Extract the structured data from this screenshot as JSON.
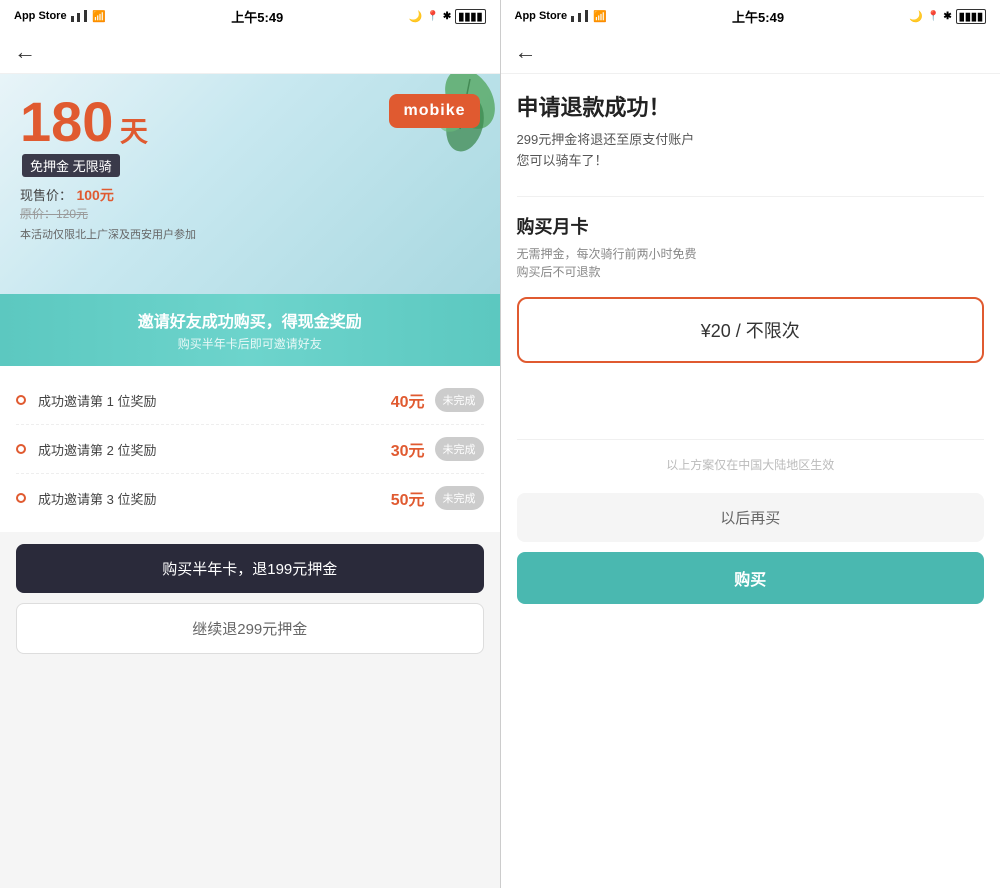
{
  "left_screen": {
    "status_bar": {
      "carrier": "App Store",
      "signal": "●●●",
      "wifi": "WiFi",
      "time": "上午5:49",
      "battery": "■■■■"
    },
    "back_label": "←",
    "hero": {
      "days": "180",
      "days_unit": "天",
      "badge_text": "免押金 无限骑",
      "price_label": "现售价：",
      "price_value": "100元",
      "original_price": "原价：120元",
      "note": "本活动仅限北上广深及西安用户参加",
      "brand": "mobike"
    },
    "invite_ribbon": {
      "title": "邀请好友成功购买，得现金奖励",
      "sub": "购买半年卡后即可邀请好友"
    },
    "rewards": [
      {
        "text": "成功邀请第 1 位奖励",
        "amount": "40元",
        "btn_label": "未完成"
      },
      {
        "text": "成功邀请第 2 位奖励",
        "amount": "30元",
        "btn_label": "未完成"
      },
      {
        "text": "成功邀请第 3 位奖励",
        "amount": "50元",
        "btn_label": "未完成"
      }
    ],
    "btn_primary": "购买半年卡，退199元押金",
    "btn_secondary": "继续退299元押金"
  },
  "right_screen": {
    "status_bar": {
      "carrier": "App Store",
      "signal": "●●●",
      "wifi": "WiFi",
      "time": "上午5:49",
      "battery": "■■■■"
    },
    "back_label": "←",
    "success_title": "申请退款成功！",
    "success_desc": "299元押金将退还至原支付账户\n您可以骑车了！",
    "monthly_card_title": "购买月卡",
    "monthly_card_desc": "无需押金，每次骑行前两小时免费\n购买后不可退款",
    "price_option": "¥20 / 不限次",
    "region_note": "以上方案仅在中国大陆地区生效",
    "btn_later": "以后再买",
    "btn_buy": "购买"
  }
}
